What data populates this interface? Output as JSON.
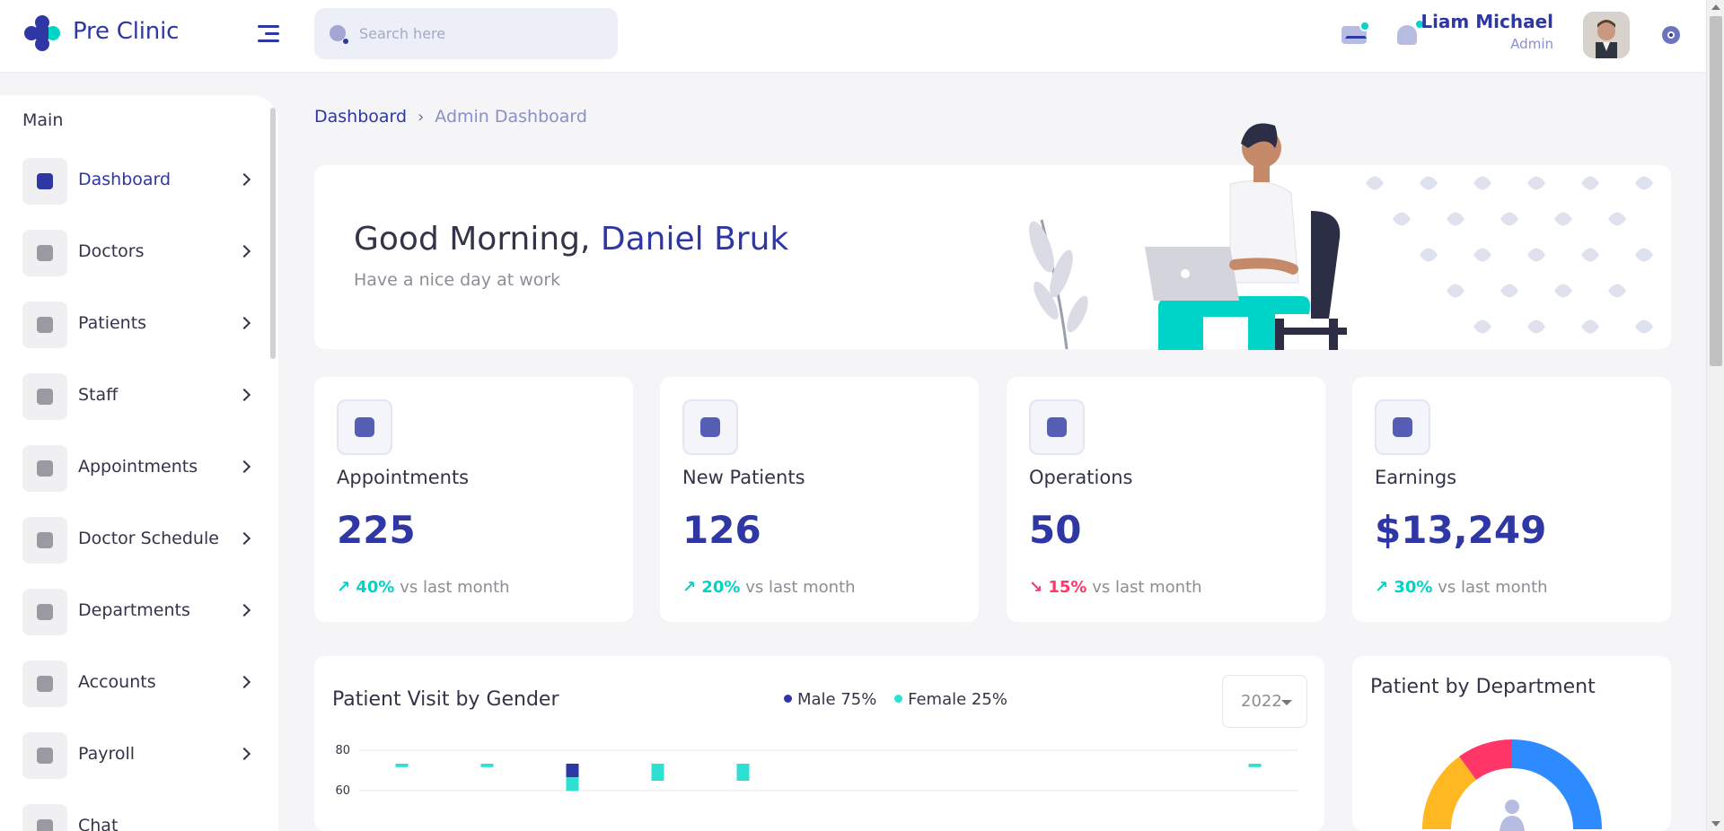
{
  "brand": {
    "name": "Pre Clinic"
  },
  "search": {
    "placeholder": "Search here"
  },
  "user": {
    "name": "Liam Michael",
    "role": "Admin"
  },
  "sidebar": {
    "section": "Main",
    "items": [
      {
        "label": "Dashboard",
        "active": true
      },
      {
        "label": "Doctors"
      },
      {
        "label": "Patients"
      },
      {
        "label": "Staff"
      },
      {
        "label": "Appointments"
      },
      {
        "label": "Doctor Schedule"
      },
      {
        "label": "Departments"
      },
      {
        "label": "Accounts"
      },
      {
        "label": "Payroll"
      },
      {
        "label": "Chat"
      }
    ]
  },
  "breadcrumb": {
    "root": "Dashboard",
    "current": "Admin Dashboard"
  },
  "welcome": {
    "greeting": "Good Morning,",
    "name": "Daniel Bruk",
    "subtitle": "Have a nice day at work"
  },
  "stats": [
    {
      "title": "Appointments",
      "value": "225",
      "change": "40%",
      "direction": "up",
      "suffix": "vs last month",
      "icon": "calendar-icon"
    },
    {
      "title": "New Patients",
      "value": "126",
      "change": "20%",
      "direction": "up",
      "suffix": "vs last month",
      "icon": "patient-icon"
    },
    {
      "title": "Operations",
      "value": "50",
      "change": "15%",
      "direction": "down",
      "suffix": "vs last month",
      "icon": "scissors-icon"
    },
    {
      "title": "Earnings",
      "value": "$13,249",
      "change": "30%",
      "direction": "up",
      "suffix": "vs last month",
      "icon": "wallet-icon"
    }
  ],
  "gender_chart": {
    "title": "Patient Visit by Gender",
    "legend": [
      {
        "label": "Male 75%",
        "color": "#2e37a4"
      },
      {
        "label": "Female 25%",
        "color": "#2ee0d2"
      }
    ],
    "year": "2022"
  },
  "chart_data": {
    "type": "bar",
    "title": "Patient Visit by Gender",
    "y_ticks": [
      80,
      60
    ],
    "ylim": [
      0,
      80
    ],
    "series": [
      {
        "name": "Male 75%",
        "values": [
          0,
          0,
          8,
          0,
          0,
          0,
          0,
          0,
          0,
          0,
          0
        ]
      },
      {
        "name": "Female 25%",
        "values": [
          2,
          2,
          8,
          10,
          10,
          0,
          0,
          0,
          0,
          0,
          2
        ]
      }
    ]
  },
  "dept_chart": {
    "title": "Patient by Department",
    "colors": [
      "#2e8bff",
      "#ff3667",
      "#ffb822"
    ]
  },
  "colors": {
    "primary": "#2e37a4",
    "accent": "#00d3c7",
    "danger": "#ff3667"
  }
}
